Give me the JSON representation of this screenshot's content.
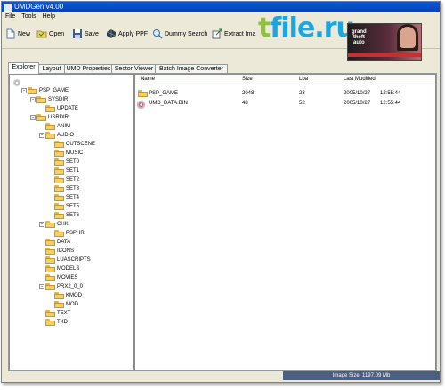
{
  "window": {
    "title": "UMDGen v4.00"
  },
  "menu": [
    "File",
    "Tools",
    "Help"
  ],
  "toolbar": {
    "new": "New",
    "open": "Open",
    "save": "Save",
    "apply_ppf": "Apply PPF",
    "dummy_search": "Dummy Search",
    "extract_image": "Extract Ima"
  },
  "watermark": {
    "t": "t",
    "rest": "file.ru"
  },
  "cover": {
    "line1": "grand",
    "line2": "theft",
    "line3": "auto",
    "band": "liberty city stories"
  },
  "tabs": [
    "Explorer",
    "Layout",
    "UMD Properties",
    "Sector Viewer",
    "Batch Image Converter"
  ],
  "tree": [
    {
      "label": "PSP_GAME",
      "exp": "-"
    },
    {
      "label": "SYSDIR",
      "exp": "-"
    },
    {
      "label": "UPDATE",
      "exp": ""
    },
    {
      "label": "USRDIR",
      "exp": "-"
    },
    {
      "label": "ANIM",
      "exp": ""
    },
    {
      "label": "AUDIO",
      "exp": "-"
    },
    {
      "label": "CUTSCENE",
      "exp": ""
    },
    {
      "label": "MUSIC",
      "exp": ""
    },
    {
      "label": "SET0",
      "exp": ""
    },
    {
      "label": "SET1",
      "exp": ""
    },
    {
      "label": "SET2",
      "exp": ""
    },
    {
      "label": "SET3",
      "exp": ""
    },
    {
      "label": "SET4",
      "exp": ""
    },
    {
      "label": "SET5",
      "exp": ""
    },
    {
      "label": "SET6",
      "exp": ""
    },
    {
      "label": "CHK",
      "exp": "-"
    },
    {
      "label": "PSPHR",
      "exp": ""
    },
    {
      "label": "DATA",
      "exp": ""
    },
    {
      "label": "ICONS",
      "exp": ""
    },
    {
      "label": "LUASCRIPTS",
      "exp": ""
    },
    {
      "label": "MODELS",
      "exp": ""
    },
    {
      "label": "MOVIES",
      "exp": ""
    },
    {
      "label": "PRX2_0_0",
      "exp": "-"
    },
    {
      "label": "KMOD",
      "exp": ""
    },
    {
      "label": "MOD",
      "exp": ""
    },
    {
      "label": "TEXT",
      "exp": ""
    },
    {
      "label": "TXD",
      "exp": ""
    }
  ],
  "columns": {
    "name": "Name",
    "size": "Size",
    "lba": "Lba",
    "modified": "Last Modified"
  },
  "files": [
    {
      "name": "PSP_GAME",
      "size": "2048",
      "lba": "23",
      "date": "2005/10/27",
      "time": "12:55:44"
    },
    {
      "name": "UMD_DATA.BIN",
      "size": "48",
      "lba": "52",
      "date": "2005/10/27",
      "time": "12:55:44"
    }
  ],
  "status": {
    "image_size": "Image Size: 1197.09 Mb"
  }
}
